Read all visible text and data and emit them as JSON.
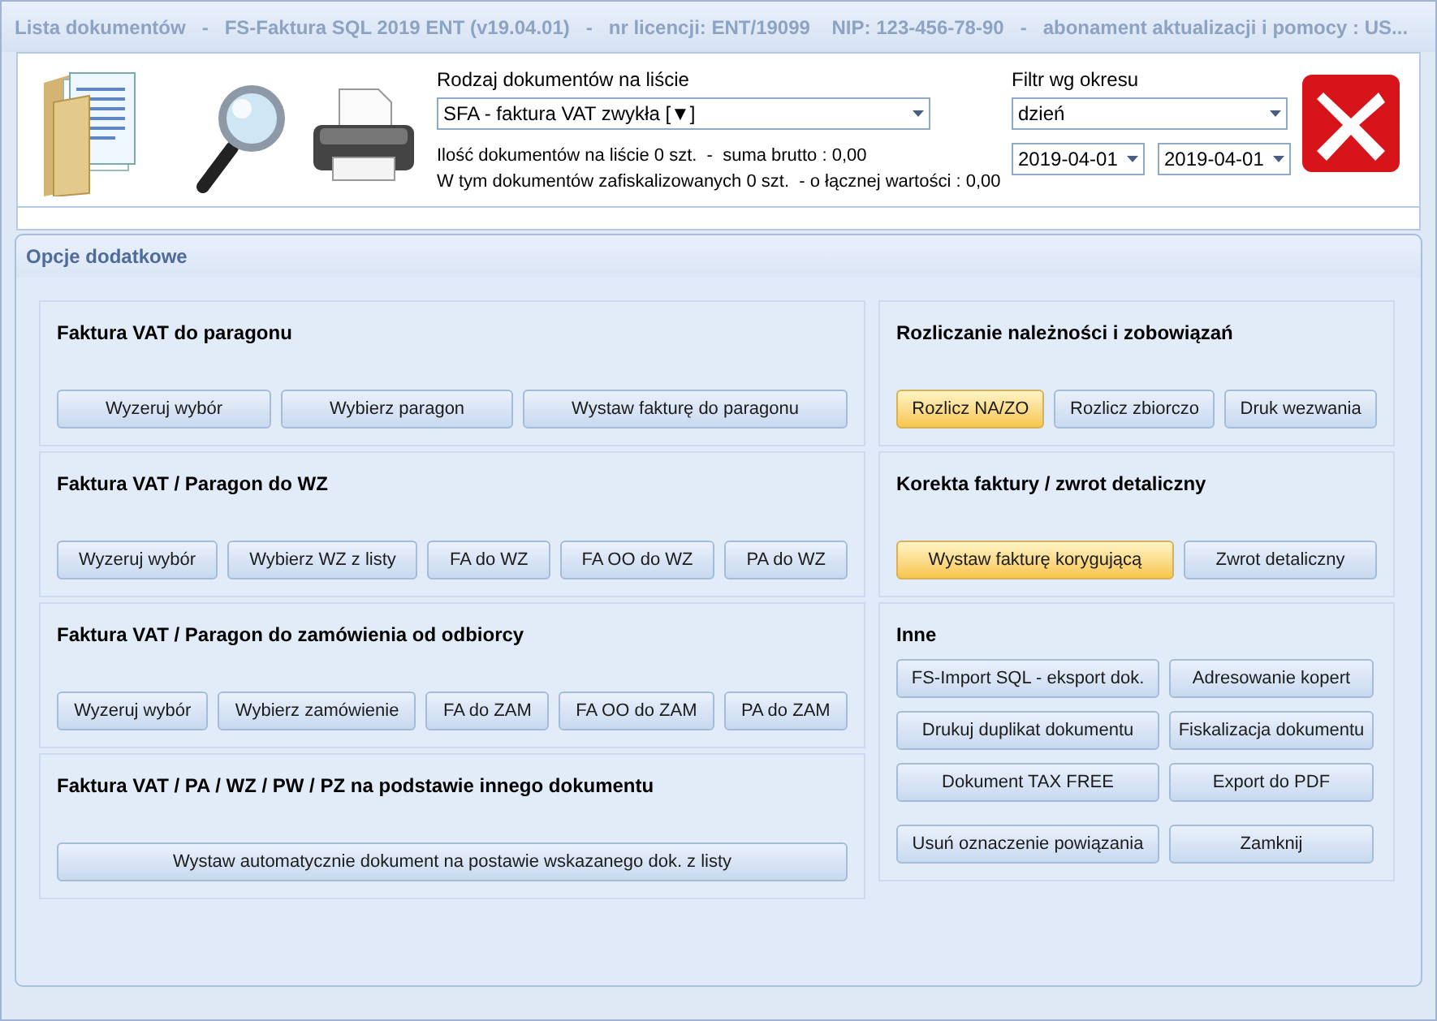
{
  "window": {
    "title": "Lista dokumentów   -   FS-Faktura SQL 2019 ENT (v19.04.01)   -   nr licencji: ENT/19099    NIP: 123-456-78-90   -   abonament aktualizacji i pomocy : US..."
  },
  "toolbar": {
    "doc_type": {
      "label": "Rodzaj dokumentów na liście",
      "value": "SFA - faktura VAT zwykła [▼]"
    },
    "summary": [
      "Ilość dokumentów na liście 0 szt.  -  suma brutto : 0,00",
      "W tym dokumentów zafiskalizowanych 0 szt.  - o łącznej wartości : 0,00"
    ],
    "period": {
      "label": "Filtr wg okresu",
      "value": "dzień",
      "date_from": "2019-04-01",
      "date_to": "2019-04-01"
    }
  },
  "options_panel": {
    "title": "Opcje dodatkowe",
    "left_sections": [
      {
        "title": "Faktura VAT do paragonu",
        "buttons": [
          {
            "label": "Wyzeruj wybór",
            "highlighted": false
          },
          {
            "label": "Wybierz paragon",
            "highlighted": false
          },
          {
            "label": "Wystaw fakturę do paragonu",
            "highlighted": false
          }
        ]
      },
      {
        "title": "Faktura VAT / Paragon do WZ",
        "buttons": [
          {
            "label": "Wyzeruj wybór",
            "highlighted": false
          },
          {
            "label": "Wybierz WZ z listy",
            "highlighted": false
          },
          {
            "label": "FA do WZ",
            "highlighted": false
          },
          {
            "label": "FA OO do WZ",
            "highlighted": false
          },
          {
            "label": "PA do WZ",
            "highlighted": false
          }
        ]
      },
      {
        "title": "Faktura VAT / Paragon do zamówienia od odbiorcy",
        "buttons": [
          {
            "label": "Wyzeruj wybór",
            "highlighted": false
          },
          {
            "label": "Wybierz zamówienie",
            "highlighted": false
          },
          {
            "label": "FA do ZAM",
            "highlighted": false
          },
          {
            "label": "FA OO do ZAM",
            "highlighted": false
          },
          {
            "label": "PA do ZAM",
            "highlighted": false
          }
        ]
      },
      {
        "title": "Faktura VAT / PA / WZ / PW / PZ  na podstawie innego dokumentu",
        "buttons": [
          {
            "label": "Wystaw automatycznie dokument na postawie wskazanego dok. z listy",
            "highlighted": false
          }
        ]
      }
    ],
    "right_sections": [
      {
        "title": "Rozliczanie należności i zobowiązań",
        "buttons": [
          {
            "label": "Rozlicz NA/ZO",
            "highlighted": true
          },
          {
            "label": "Rozlicz zbiorczo",
            "highlighted": false
          },
          {
            "label": "Druk wezwania",
            "highlighted": false
          }
        ]
      },
      {
        "title": "Korekta faktury / zwrot detaliczny",
        "buttons": [
          {
            "label": "Wystaw fakturę korygującą",
            "highlighted": true
          },
          {
            "label": "Zwrot detaliczny",
            "highlighted": false
          }
        ]
      }
    ],
    "other": {
      "title": "Inne",
      "buttons": [
        {
          "label": "FS-Import SQL - eksport dok.",
          "highlighted": false
        },
        {
          "label": "Adresowanie kopert",
          "highlighted": false
        },
        {
          "label": "Drukuj duplikat dokumentu",
          "highlighted": false
        },
        {
          "label": "Fiskalizacja dokumentu",
          "highlighted": false
        },
        {
          "label": "Dokument TAX FREE",
          "highlighted": false
        },
        {
          "label": "Export do PDF",
          "highlighted": false
        },
        {
          "label": "Usuń oznaczenie powiązania",
          "highlighted": false
        },
        {
          "label": "Zamknij",
          "highlighted": false
        }
      ]
    }
  }
}
